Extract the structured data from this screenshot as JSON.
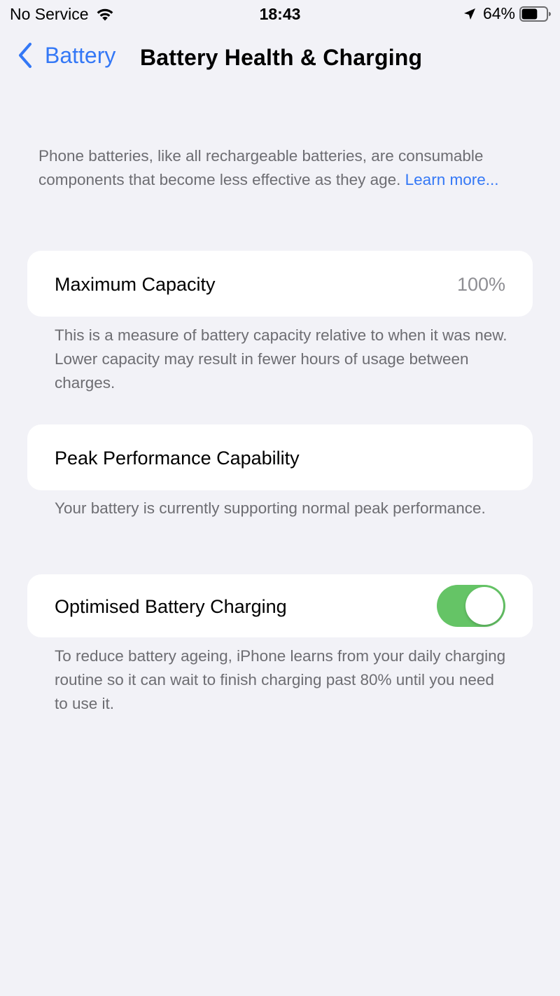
{
  "status_bar": {
    "carrier": "No Service",
    "time": "18:43",
    "battery_percent": "64%",
    "battery_level": 0.64,
    "icons": [
      "wifi-icon",
      "location-arrow-icon",
      "battery-icon"
    ]
  },
  "nav": {
    "back_label": "Battery",
    "title": "Battery Health & Charging"
  },
  "intro": {
    "text": "Phone batteries, like all rechargeable batteries, are consumable components that become less effective as they age. ",
    "link": "Learn more..."
  },
  "max_capacity": {
    "label": "Maximum Capacity",
    "value": "100%",
    "footnote": "This is a measure of battery capacity relative to when it was new. Lower capacity may result in fewer hours of usage between charges."
  },
  "peak_performance": {
    "label": "Peak Performance Capability",
    "footnote": "Your battery is currently supporting normal peak performance."
  },
  "optimised_charging": {
    "label": "Optimised Battery Charging",
    "enabled": true,
    "footnote": "To reduce battery ageing, iPhone learns from your daily charging routine so it can wait to finish charging past 80% until you need to use it."
  },
  "colors": {
    "accent": "#3478f6",
    "toggle_on": "#65c466",
    "background": "#f2f2f7",
    "secondary_text": "#6d6d72"
  }
}
